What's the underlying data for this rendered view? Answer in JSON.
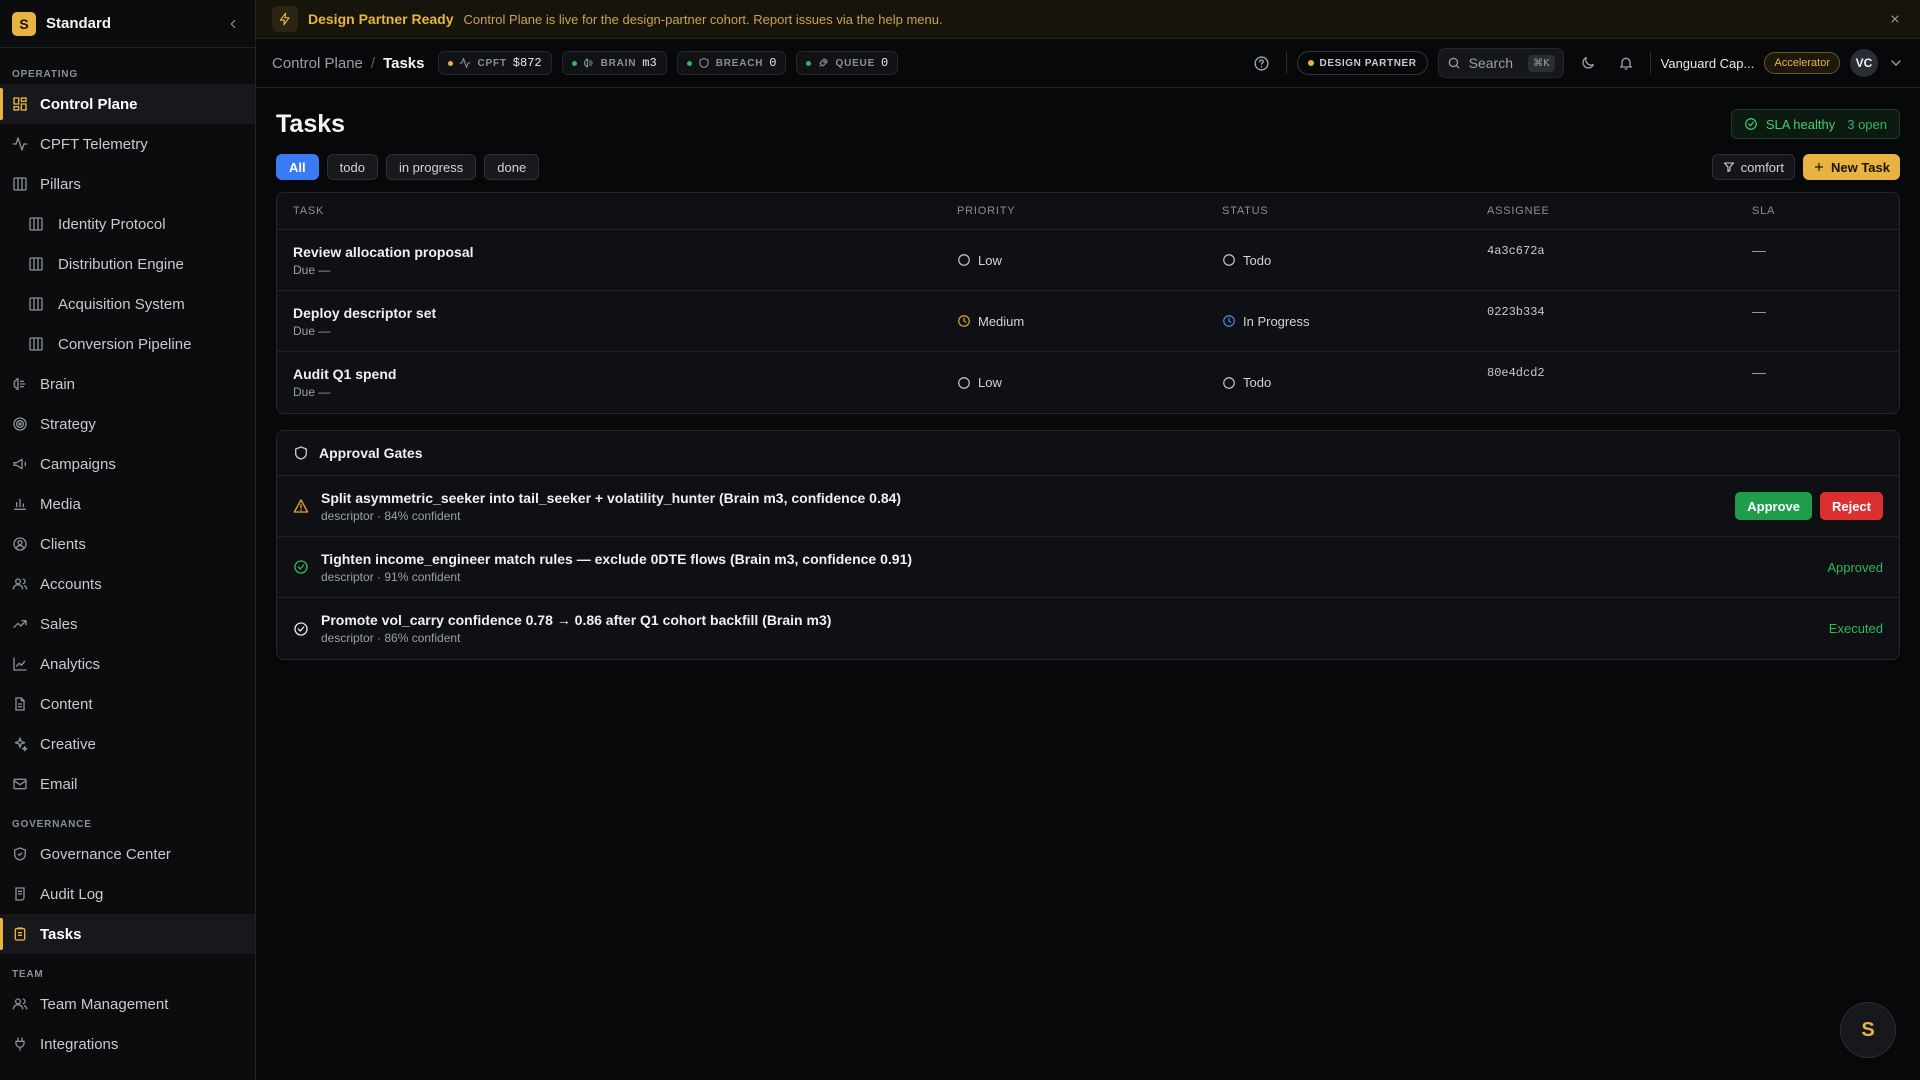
{
  "brand": {
    "logo_letter": "S",
    "name": "Standard"
  },
  "sidebar": {
    "sections": {
      "operating": "OPERATING",
      "governance": "GOVERNANCE",
      "team": "TEAM"
    },
    "items": {
      "control_plane": "Control Plane",
      "cpft_telemetry": "CPFT Telemetry",
      "pillars": "Pillars",
      "identity_protocol": "Identity Protocol",
      "distribution_engine": "Distribution Engine",
      "acquisition_system": "Acquisition System",
      "conversion_pipeline": "Conversion Pipeline",
      "brain": "Brain",
      "strategy": "Strategy",
      "campaigns": "Campaigns",
      "media": "Media",
      "clients": "Clients",
      "accounts": "Accounts",
      "sales": "Sales",
      "analytics": "Analytics",
      "content": "Content",
      "creative": "Creative",
      "email": "Email",
      "governance_center": "Governance Center",
      "audit_log": "Audit Log",
      "tasks": "Tasks",
      "team_management": "Team Management",
      "integrations": "Integrations"
    }
  },
  "banner": {
    "title": "Design Partner Ready",
    "text": "Control Plane is live for the design-partner cohort. Report issues via the help menu."
  },
  "topbar": {
    "breadcrumb_parent": "Control Plane",
    "breadcrumb_sep": "/",
    "breadcrumb_current": "Tasks",
    "metrics": {
      "cpft": {
        "label": "CPFT",
        "value": "$872",
        "color": "#e8b341"
      },
      "brain": {
        "label": "BRAIN",
        "value": "m3",
        "color": "#2fb75b"
      },
      "breach": {
        "label": "BREACH",
        "value": "0",
        "color": "#2fb75b"
      },
      "queue": {
        "label": "QUEUE",
        "value": "0",
        "color": "#2fb75b"
      }
    },
    "partner_pill": "DESIGN PARTNER",
    "search_placeholder": "Search",
    "search_shortcut": "⌘K",
    "org_name": "Vanguard Cap...",
    "org_badge": "Accelerator",
    "avatar_initials": "VC"
  },
  "page": {
    "title": "Tasks",
    "sla": {
      "label": "SLA healthy",
      "count": "3 open"
    },
    "filters": {
      "all": "All",
      "todo": "todo",
      "in_progress": "in progress",
      "done": "done"
    },
    "density_label": "comfort",
    "new_task_label": "New Task"
  },
  "table": {
    "headers": {
      "task": "TASK",
      "priority": "PRIORITY",
      "status": "STATUS",
      "assignee": "ASSIGNEE",
      "sla": "SLA"
    },
    "rows": [
      {
        "task": "Review allocation proposal",
        "due": "Due —",
        "priority": "Low",
        "priority_icon": "circle-icon",
        "status": "Todo",
        "status_icon": "circle-icon",
        "assignee": "4a3c672a",
        "sla": "—"
      },
      {
        "task": "Deploy descriptor set",
        "due": "Due —",
        "priority": "Medium",
        "priority_icon": "clock-icon",
        "status": "In Progress",
        "status_icon": "clock-icon",
        "assignee": "0223b334",
        "sla": "—"
      },
      {
        "task": "Audit Q1 spend",
        "due": "Due —",
        "priority": "Low",
        "priority_icon": "circle-icon",
        "status": "Todo",
        "status_icon": "circle-icon",
        "assignee": "80e4dcd2",
        "sla": "—"
      }
    ]
  },
  "gates": {
    "title": "Approval Gates",
    "items": [
      {
        "title": "Split asymmetric_seeker into tail_seeker + volatility_hunter (Brain m3, confidence 0.84)",
        "sub": "descriptor · 84% confident",
        "icon": "warning-icon",
        "approve_label": "Approve",
        "reject_label": "Reject"
      },
      {
        "title": "Tighten income_engineer match rules — exclude 0DTE flows (Brain m3, confidence 0.91)",
        "sub": "descriptor · 91% confident",
        "icon": "check-circle-icon",
        "state": "Approved"
      },
      {
        "title": "Promote vol_carry confidence 0.78 → 0.86 after Q1 cohort backfill (Brain m3)",
        "sub": "descriptor · 86% confident",
        "icon": "check-circle-icon",
        "state": "Executed"
      }
    ]
  },
  "fab_letter": "S",
  "colors": {
    "accent": "#e8b341",
    "primary_blue": "#3a7af2",
    "success": "#2fb75b",
    "danger": "#dc2f2f",
    "warning": "#e8a33a",
    "info": "#4a8bf0"
  }
}
